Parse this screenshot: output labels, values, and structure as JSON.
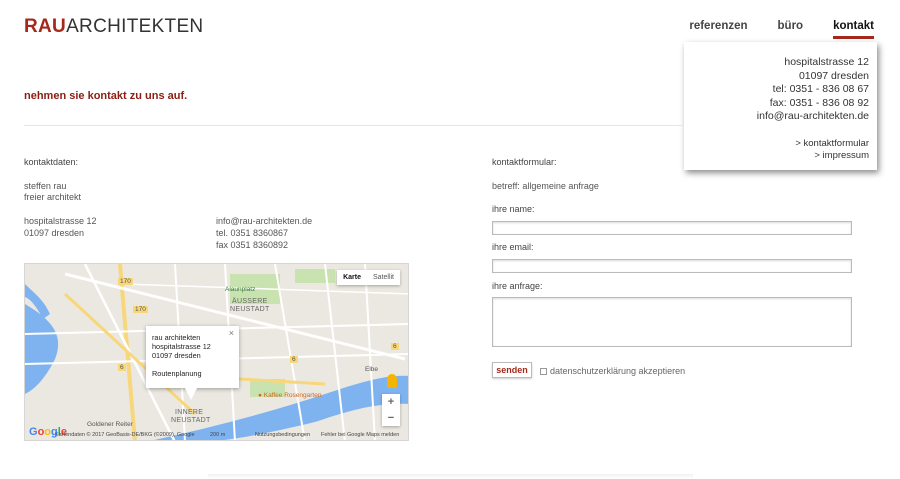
{
  "header": {
    "logo_brand": "RAU",
    "logo_rest": "ARCHITEKTEN",
    "nav": [
      {
        "label": "referenzen"
      },
      {
        "label": "büro"
      },
      {
        "label": "kontakt"
      }
    ]
  },
  "popup": {
    "street": "hospitalstrasse 12",
    "city": "01097 dresden",
    "tel": "tel: 0351 - 836 08 67",
    "fax": "fax: 0351 - 836 08 92",
    "email": "info@rau-architekten.de",
    "link_form": "> kontaktformular",
    "link_impressum": "> impressum"
  },
  "headline": "nehmen sie kontakt zu uns auf.",
  "contact": {
    "title": "kontaktdaten:",
    "name": "steffen rau",
    "role": "freier architekt",
    "street": "hospitalstrasse 12",
    "city": "01097 dresden",
    "email": "info@rau-architekten.de",
    "tel": "tel. 0351 8360867",
    "fax": "fax 0351 8360892"
  },
  "map": {
    "type_map": "Karte",
    "type_satellite": "Satellit",
    "info_title": "rau architekten",
    "info_street": "hospitalstrasse 12",
    "info_city": "01097 dresden",
    "info_route": "Routenplanung",
    "close": "×",
    "zoom_in": "+",
    "zoom_out": "−",
    "labels": {
      "alaunplatz": "Alaunplatz",
      "aeussere1": "ÄUSSERE",
      "aeussere2": "NEUSTADT",
      "innere1": "INNERE",
      "innere2": "NEUSTADT",
      "kaffee": "Kaffee Rosengarten",
      "elbe": "Elbe",
      "goldener": "Goldener Reiter",
      "road170a": "170",
      "road170b": "170",
      "road6a": "6",
      "road6b": "6",
      "road6c": "6"
    },
    "footer_data": "Kartendaten © 2017 GeoBasis-DE/BKG (©2009), Google",
    "footer_scale": "200 m",
    "footer_terms": "Nutzungsbedingungen",
    "footer_report": "Fehler bei Google Maps melden",
    "google": "Google"
  },
  "form": {
    "title": "kontaktformular:",
    "subject": "betreff: allgemeine anfrage",
    "name_label": "ihre name:",
    "email_label": "ihre email:",
    "request_label": "ihre anfrage:",
    "send": "senden",
    "privacy": "datenschutzerklärung akzeptieren"
  }
}
